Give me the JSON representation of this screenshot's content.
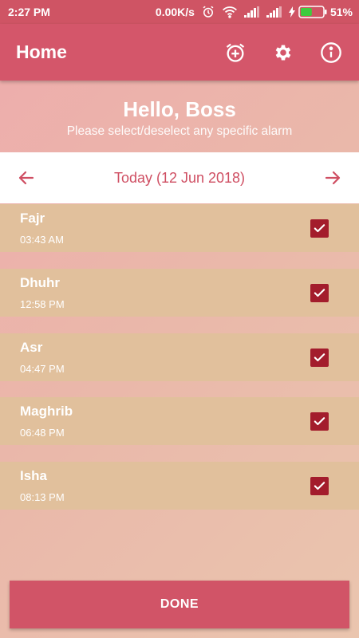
{
  "status_bar": {
    "time": "2:27 PM",
    "network_speed": "0.00K/s",
    "battery_percent": "51%",
    "battery_level": 0.51,
    "icons": [
      "alarm-clock-icon",
      "wifi-icon",
      "signal-icon",
      "signal-icon",
      "charging-icon",
      "battery-icon"
    ]
  },
  "app_bar": {
    "title": "Home",
    "actions": [
      "add-alarm-icon",
      "gear-icon",
      "info-icon"
    ]
  },
  "greeting": {
    "title": "Hello, Boss",
    "subtitle": "Please select/deselect any specific alarm"
  },
  "date_nav": {
    "label": "Today (12 Jun 2018)",
    "prev_icon": "arrow-left-icon",
    "next_icon": "arrow-right-icon"
  },
  "alarms": [
    {
      "name": "Fajr",
      "time": "03:43 AM",
      "checked": true
    },
    {
      "name": "Dhuhr",
      "time": "12:58 PM",
      "checked": true
    },
    {
      "name": "Asr",
      "time": "04:47 PM",
      "checked": true
    },
    {
      "name": "Maghrib",
      "time": "06:48 PM",
      "checked": true
    },
    {
      "name": "Isha",
      "time": "08:13 PM",
      "checked": true
    }
  ],
  "done_label": "DONE",
  "colors": {
    "primary": "#d4566a",
    "status_bar": "#cf5464",
    "row": "#e1c09c",
    "checkbox": "#a31c2c",
    "battery": "#3ecb3e"
  }
}
